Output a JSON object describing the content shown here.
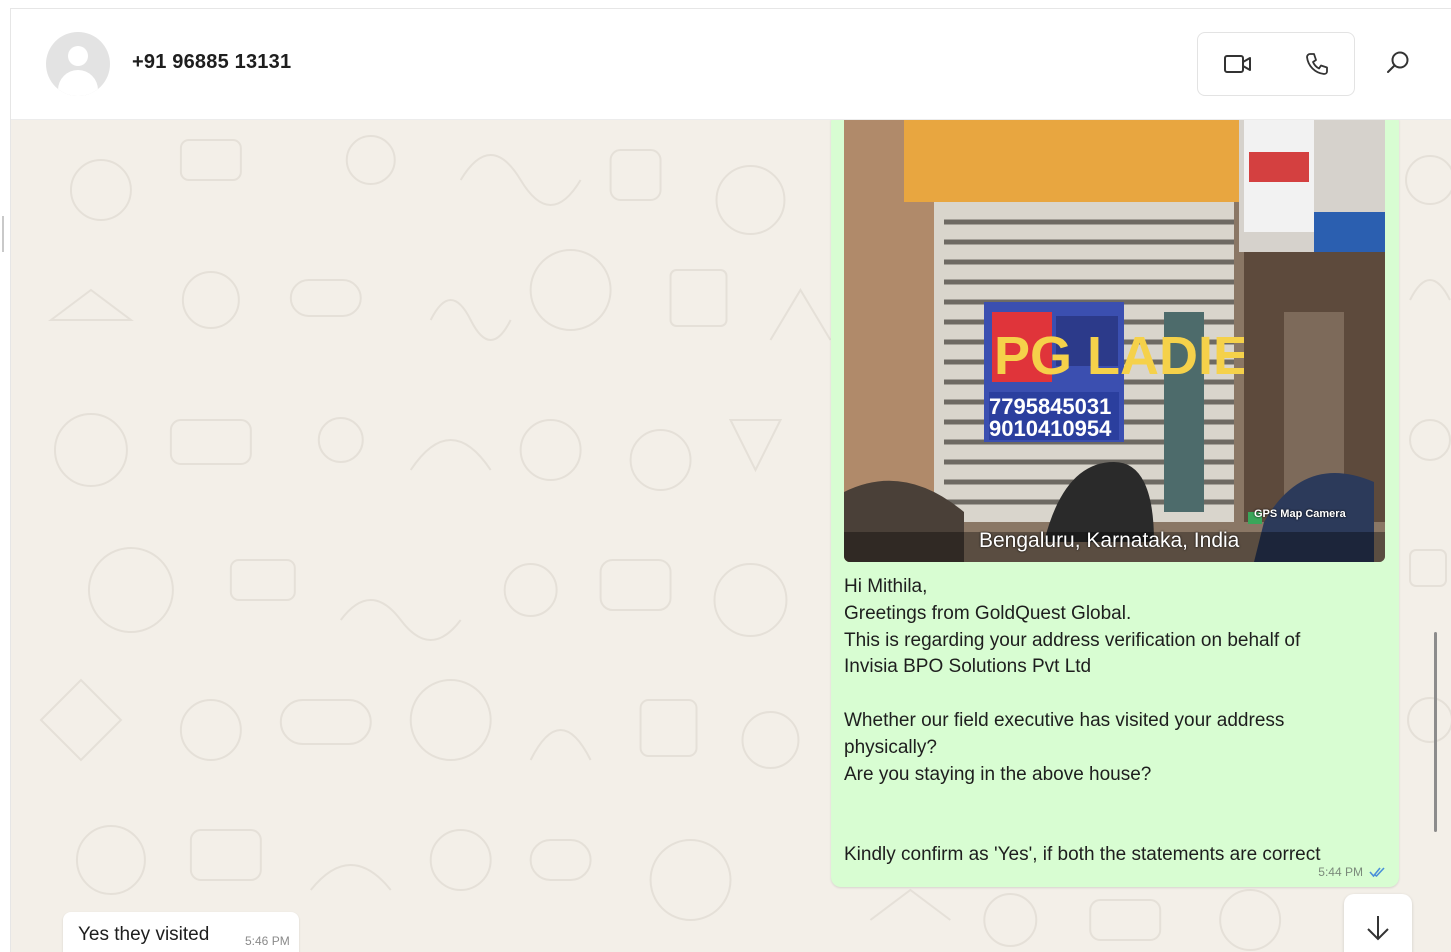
{
  "header": {
    "contact_name": "+91 96885 13131",
    "icons": {
      "avatar": "person-icon",
      "video_call": "video-camera-icon",
      "voice_call": "phone-icon",
      "search": "search-icon"
    }
  },
  "messages": {
    "outgoing": {
      "photo": {
        "location_overlay": "Bengaluru, Karnataka, India",
        "watermark": "GPS Map Camera",
        "sign_text": "PG LADIES",
        "sign_phone_1": "7795845031",
        "sign_phone_2": "9010410954"
      },
      "lines": [
        "Hi Mithila,",
        "Greetings from GoldQuest Global.",
        "This is regarding your address verification on behalf of",
        "Invisia BPO Solutions Pvt Ltd",
        "",
        "Whether our field executive has visited your address",
        "physically?",
        "Are you staying in the above house?",
        "",
        "",
        "Kindly confirm as 'Yes', if both the statements are correct"
      ],
      "time": "5:44 PM",
      "status_icon": "double-check-icon"
    },
    "incoming": {
      "text": "Yes they visited",
      "time": "5:46 PM"
    }
  },
  "controls": {
    "scroll_down_icon": "arrow-down-icon"
  },
  "colors": {
    "outgoing_bubble": "#d8fdd2",
    "incoming_bubble": "#ffffff",
    "chat_background": "#f3efe8",
    "read_tick": "#4a8fd9"
  }
}
